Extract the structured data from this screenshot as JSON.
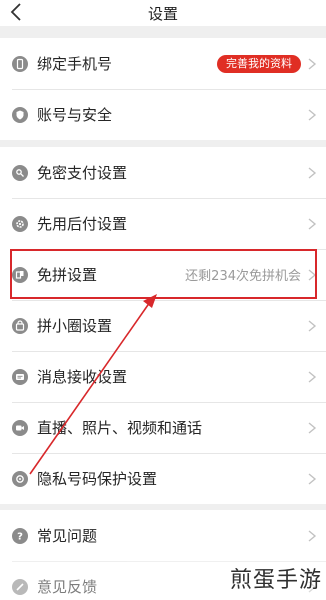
{
  "header": {
    "title": "设置"
  },
  "group1": [
    {
      "label": "绑定手机号",
      "badge": "完善我的资料"
    },
    {
      "label": "账号与安全"
    }
  ],
  "group2": [
    {
      "label": "免密支付设置"
    },
    {
      "label": "先用后付设置"
    },
    {
      "label": "免拼设置",
      "hint": "还剩234次免拼机会"
    },
    {
      "label": "拼小圈设置"
    },
    {
      "label": "消息接收设置"
    },
    {
      "label": "直播、照片、视频和通话"
    },
    {
      "label": "隐私号码保护设置"
    }
  ],
  "group3": [
    {
      "label": "常见问题"
    },
    {
      "label": "意见反馈"
    }
  ],
  "watermark": "煎蛋手游",
  "colors": {
    "accent": "#e02e24",
    "highlight": "#d8282b",
    "icon": "#8b8b8b"
  },
  "icons": [
    "phone-icon",
    "shield-icon",
    "key-icon",
    "gear-icon",
    "coupon-icon",
    "bag-icon",
    "message-icon",
    "video-icon",
    "privacy-icon",
    "question-icon",
    "feedback-icon"
  ]
}
